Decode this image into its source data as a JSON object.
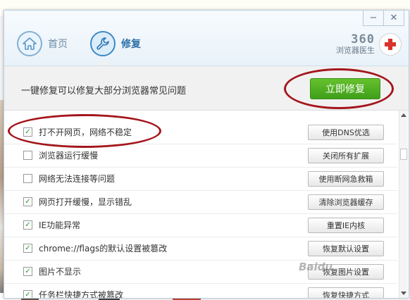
{
  "window": {
    "minimize_glyph": "−",
    "close_glyph": "✕"
  },
  "nav": {
    "home_label": "首页",
    "repair_label": "修复"
  },
  "brand": {
    "number": "360",
    "subtitle": "浏览器医生"
  },
  "banner": {
    "text": "一键修复可以修复大部分浏览器常见问题",
    "button_label": "立即修复"
  },
  "items": [
    {
      "label": "打不开网页，网络不稳定",
      "checked": true,
      "action": "使用DNS优选"
    },
    {
      "label": "浏览器运行缓慢",
      "checked": false,
      "action": "关闭所有扩展"
    },
    {
      "label": "网络无法连接等问题",
      "checked": false,
      "action": "使用断网急救箱"
    },
    {
      "label": "网页打开缓慢，显示错乱",
      "checked": true,
      "action": "清除浏览器缓存"
    },
    {
      "label": "IE功能异常",
      "checked": true,
      "action": "重置IE内核"
    },
    {
      "label": "chrome://flags的默认设置被篡改",
      "checked": true,
      "action": "恢复默认设置"
    },
    {
      "label": "图片不显示",
      "checked": true,
      "action": "恢复图片设置"
    },
    {
      "label": "任务栏快捷方式被篡改",
      "checked": true,
      "action": "恢复快捷方式"
    }
  ],
  "check_glyph": "✓",
  "watermark": "Baidu"
}
